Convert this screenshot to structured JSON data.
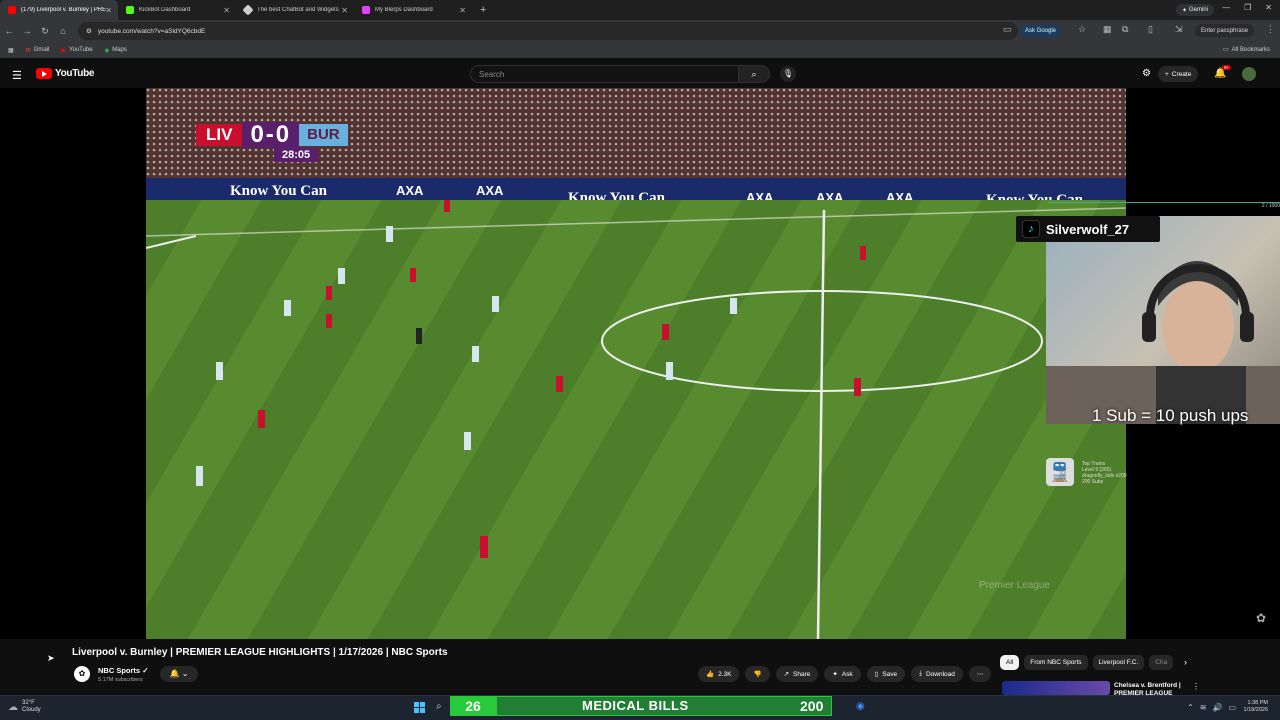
{
  "browser": {
    "tabs": [
      {
        "label": "(179) Liverpool v. Burnley | PRE",
        "active": true,
        "color": "#ff0000"
      },
      {
        "label": "KickBot Dashboard",
        "active": false,
        "color": "#53fc18"
      },
      {
        "label": "The best ChatBot and Widgets",
        "active": false,
        "color": "#cccccc"
      },
      {
        "label": "My Blerps Dashboard",
        "active": false,
        "color": "#e040fb"
      }
    ],
    "gemini_label": "Gemini",
    "url": "youtube.com/watch?v=aSldYQ6cbdE",
    "ask_google_label": "Ask Google",
    "passphrase_label": "Enter passphrase",
    "bookmarks": [
      "Gmail",
      "YouTube",
      "Maps"
    ],
    "all_bookmarks_label": "All Bookmarks"
  },
  "youtube": {
    "logo_text": "YouTube",
    "search_placeholder": "Search",
    "create_label": "Create",
    "notif_count": "9+"
  },
  "video": {
    "score": {
      "home": "LIV",
      "away": "BUR",
      "score_text": "0-0",
      "clock": "28:05"
    },
    "banner_text": "Know You Can",
    "sponsor": "AXA",
    "watermark": "Premier League",
    "overlay": {
      "tiktok_user": "Silverwolf_27",
      "sub_goal": "1 Sub = 10 push ups",
      "top_info": "2 / 1000",
      "train": {
        "title": "Top Trains",
        "line1": "Level 9 (265)",
        "line2": "dragonfly_kidx x209",
        "line3": "200 Subs"
      }
    }
  },
  "meta": {
    "title": "Liverpool v. Burnley | PREMIER LEAGUE HIGHLIGHTS | 1/17/2026 | NBC Sports",
    "channel": "NBC Sports",
    "subscribers": "5.17M subscribers",
    "actions": {
      "likes": "2.3K",
      "share": "Share",
      "ask": "Ask",
      "save": "Save",
      "download": "Download"
    }
  },
  "recommendations": {
    "chips": [
      "All",
      "From NBC Sports",
      "Liverpool F.C.",
      "Cha"
    ],
    "first_title": "Chelsea v. Brentford | PREMIER LEAGUE"
  },
  "taskbar": {
    "temp": "32°F",
    "condition": "Cloudy",
    "goal_left": "26",
    "goal_label": "MEDICAL BILLS",
    "goal_right": "200",
    "time": "1:38 PM",
    "date": "1/18/2026"
  }
}
